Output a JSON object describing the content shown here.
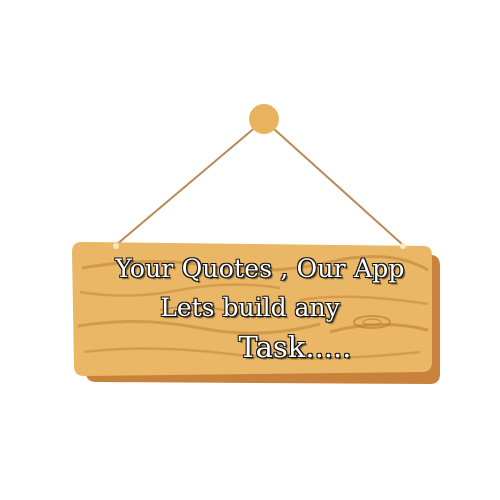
{
  "sign": {
    "line1": "Your Quotes , Our App",
    "line2": "Lets build any",
    "line3": "Task....."
  },
  "colors": {
    "wood": "#e9b765",
    "wood_dark": "#b5732f",
    "wood_shadow": "#c8823c",
    "rope": "#b88a55",
    "nail": "#e8b25e",
    "text_fill": "#ffffff",
    "text_outline": "#111111"
  },
  "icons": [
    "nail-icon",
    "rope-icon",
    "wood-board-icon"
  ]
}
